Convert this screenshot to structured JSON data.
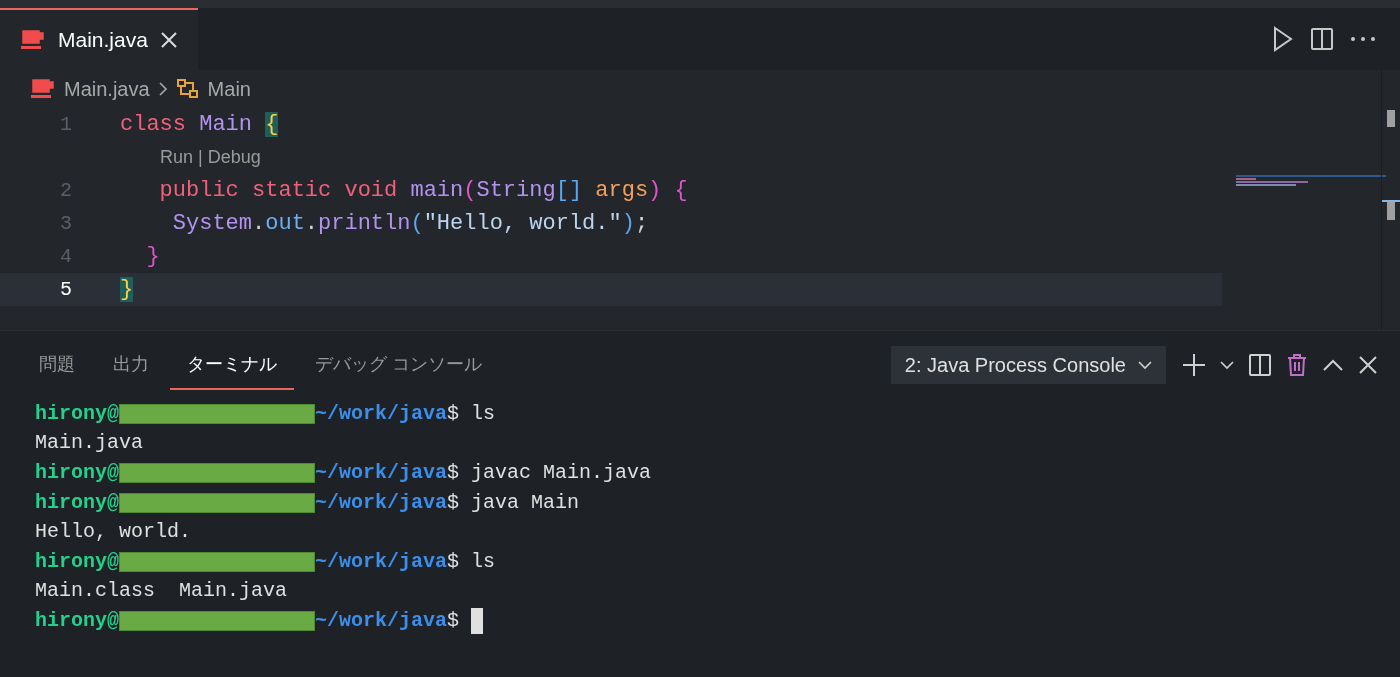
{
  "editor_tabs": [
    {
      "label": "Main.java",
      "selected": true
    }
  ],
  "breadcrumbs": [
    "Main.java",
    "Main"
  ],
  "code_lines": [
    {
      "number": "1",
      "current": false,
      "tokens": [
        {
          "text": "class ",
          "kind": "keyword"
        },
        {
          "text": "Main ",
          "kind": "type"
        },
        {
          "text": "{",
          "kind": "match"
        }
      ]
    },
    {
      "number": "2",
      "current": false,
      "codelens": "Run | Debug",
      "tokens": [
        {
          "text": "   public static void ",
          "kind": "keyword"
        },
        {
          "text": "main",
          "kind": "function"
        },
        {
          "text": "(",
          "kind": "paren"
        },
        {
          "text": "String",
          "kind": "type"
        },
        {
          "text": "[] ",
          "kind": "bracket"
        },
        {
          "text": "args",
          "kind": "param"
        },
        {
          "text": ") {",
          "kind": "paren"
        }
      ]
    },
    {
      "number": "3",
      "current": false,
      "tokens": [
        {
          "text": "    System",
          "kind": "type"
        },
        {
          "text": ".",
          "kind": "plain"
        },
        {
          "text": "out",
          "kind": "variable"
        },
        {
          "text": ".",
          "kind": "plain"
        },
        {
          "text": "println",
          "kind": "function"
        },
        {
          "text": "(",
          "kind": "bracket"
        },
        {
          "text": "\"Hello, world.\"",
          "kind": "string"
        },
        {
          "text": ")",
          "kind": "bracket"
        },
        {
          "text": ";",
          "kind": "plain"
        }
      ]
    },
    {
      "number": "4",
      "current": false,
      "tokens": [
        {
          "text": "  }",
          "kind": "paren"
        }
      ]
    },
    {
      "number": "5",
      "current": true,
      "tokens": [
        {
          "text": "}",
          "kind": "match"
        }
      ]
    }
  ],
  "panel_tabs": [
    {
      "label": "問題",
      "selected": false
    },
    {
      "label": "出力",
      "selected": false
    },
    {
      "label": "ターミナル",
      "selected": true
    },
    {
      "label": "デバッグ コンソール",
      "selected": false
    }
  ],
  "terminal_select": "2: Java Process Console",
  "terminal_lines": [
    {
      "kind": "prompt",
      "user": "hirony@",
      "path": "~/work/java",
      "sign": "$",
      "command": " ls",
      "cursor": false
    },
    {
      "kind": "output",
      "text": "Main.java"
    },
    {
      "kind": "prompt",
      "user": "hirony@",
      "path": "~/work/java",
      "sign": "$",
      "command": " javac Main.java",
      "cursor": false
    },
    {
      "kind": "prompt",
      "user": "hirony@",
      "path": "~/work/java",
      "sign": "$",
      "command": " java Main",
      "cursor": false
    },
    {
      "kind": "output",
      "text": "Hello, world."
    },
    {
      "kind": "prompt",
      "user": "hirony@",
      "path": "~/work/java",
      "sign": "$",
      "command": " ls",
      "cursor": false
    },
    {
      "kind": "output",
      "text": "Main.class  Main.java"
    },
    {
      "kind": "prompt",
      "user": "hirony@",
      "path": "~/work/java",
      "sign": "$",
      "cursor": true
    }
  ]
}
